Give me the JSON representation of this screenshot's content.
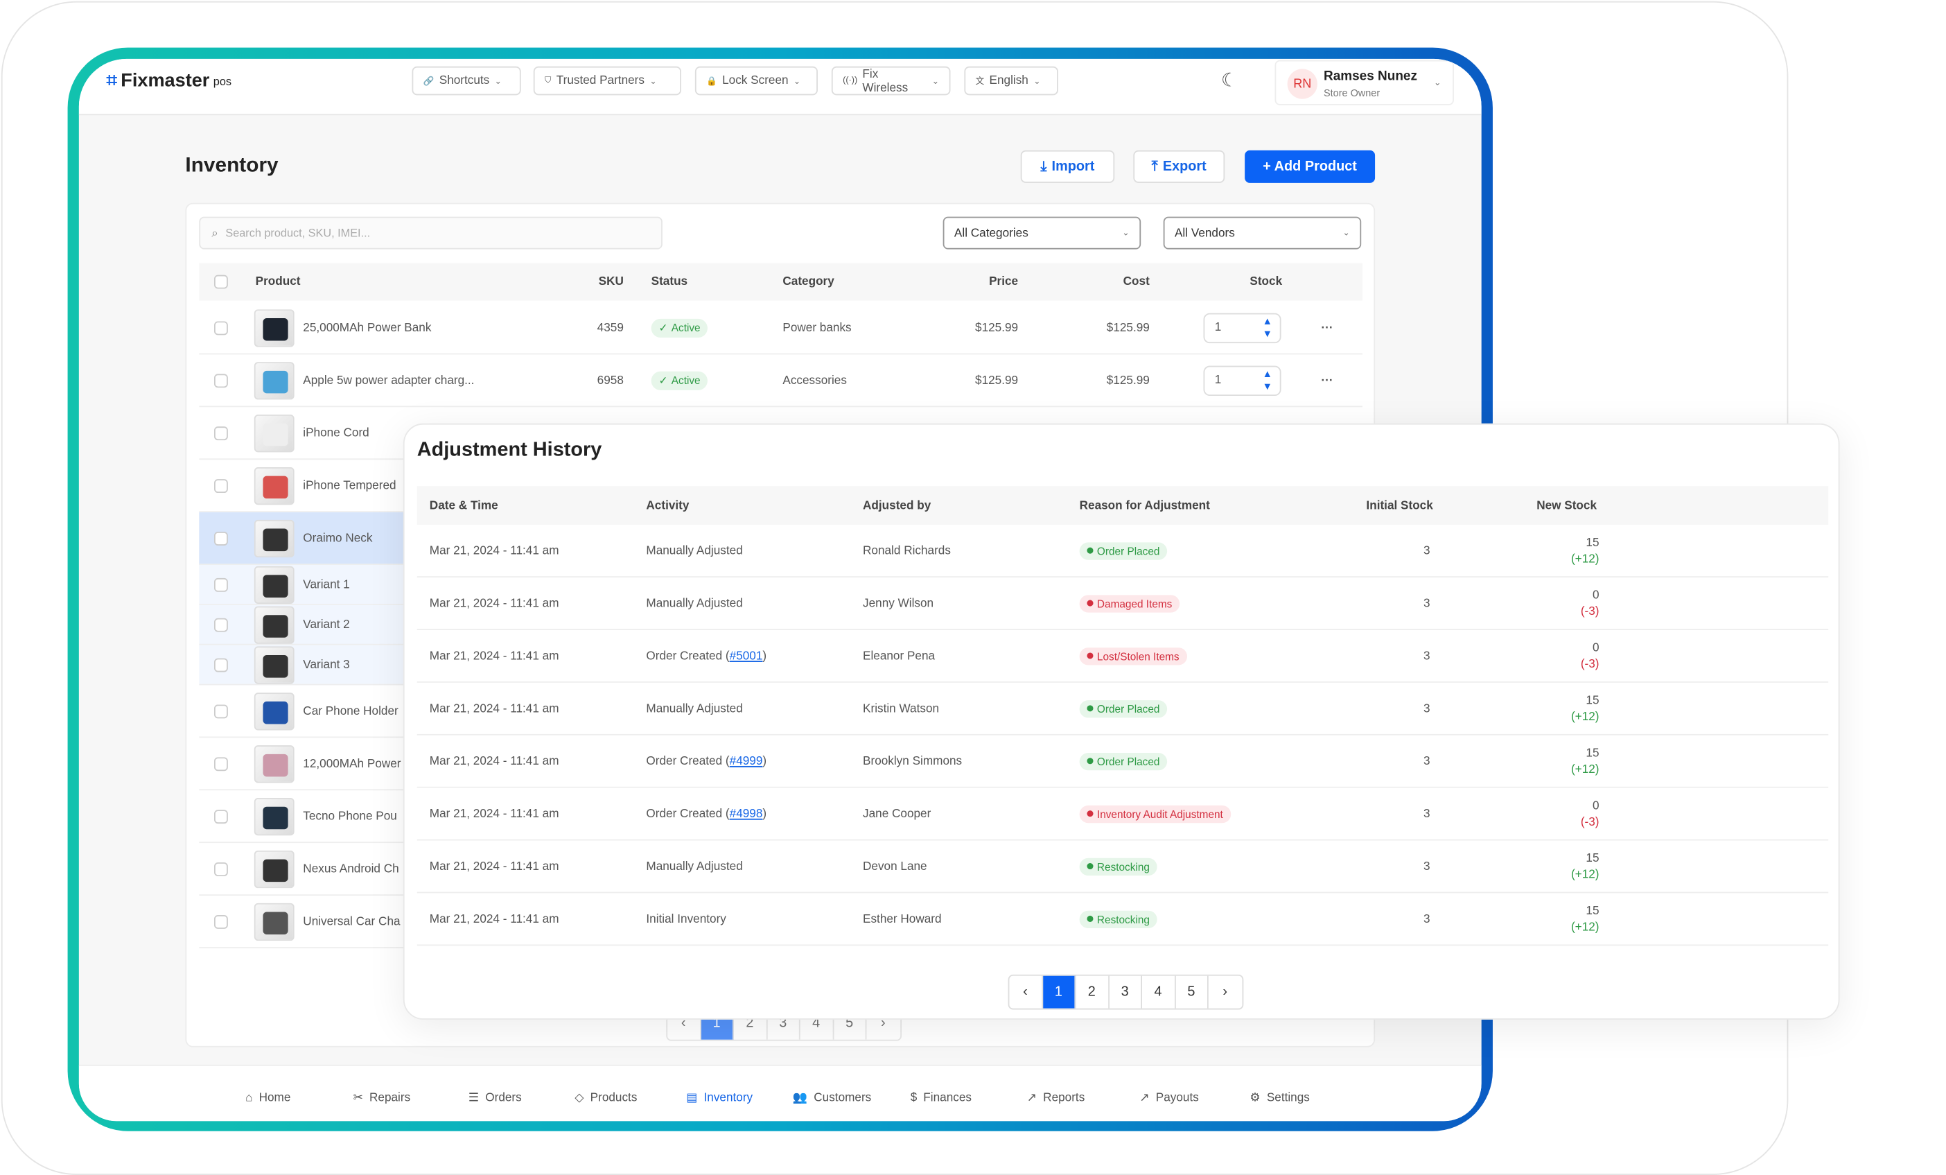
{
  "app": {
    "logo": "Fixmaster",
    "logo_sup": "pos"
  },
  "header": {
    "menus": [
      {
        "label": "Shortcuts",
        "icon": "link-icon"
      },
      {
        "label": "Trusted Partners",
        "icon": "shield-icon"
      },
      {
        "label": "Lock Screen",
        "icon": "lock-icon"
      },
      {
        "label": "Fix Wireless",
        "icon": "wireless-icon"
      },
      {
        "label": "English",
        "icon": "translate-icon"
      }
    ],
    "user": {
      "initials": "RN",
      "name": "Ramses Nunez",
      "role": "Store Owner"
    }
  },
  "page": {
    "title": "Inventory",
    "import": "Import",
    "export": "Export",
    "add": "+ Add Product"
  },
  "filters": {
    "search_placeholder": "Search product, SKU, IMEI...",
    "category": "All Categories",
    "vendor": "All Vendors"
  },
  "table": {
    "headers": {
      "product": "Product",
      "sku": "SKU",
      "status": "Status",
      "category": "Category",
      "price": "Price",
      "cost": "Cost",
      "stock": "Stock"
    },
    "rows": [
      {
        "name": "25,000MAh Power Bank",
        "sku": "4359",
        "status": "Active",
        "category": "Power banks",
        "price": "$125.99",
        "cost": "$125.99",
        "stock": "1"
      },
      {
        "name": "Apple 5w power adapter charg...",
        "sku": "6958",
        "status": "Active",
        "category": "Accessories",
        "price": "$125.99",
        "cost": "$125.99",
        "stock": "1"
      },
      {
        "name": "iPhone Cord"
      },
      {
        "name": "iPhone Tempered"
      },
      {
        "name": "Oraimo Neck"
      },
      {
        "name": "Variant 1"
      },
      {
        "name": "Variant 2"
      },
      {
        "name": "Variant 3"
      },
      {
        "name": "Car Phone Holder"
      },
      {
        "name": "12,000MAh Power"
      },
      {
        "name": "Tecno Phone Pou"
      },
      {
        "name": "Nexus Android Ch"
      },
      {
        "name": "Universal Car Cha"
      }
    ]
  },
  "modal": {
    "title": "Adjustment History",
    "headers": {
      "date": "Date & Time",
      "activity": "Activity",
      "by": "Adjusted by",
      "reason": "Reason for Adjustment",
      "initial": "Initial Stock",
      "new": "New Stock"
    },
    "rows": [
      {
        "date": "Mar 21, 2024 - 11:41 am",
        "activity": "Manually Adjusted",
        "order": "",
        "by": "Ronald Richards",
        "reason": "Order Placed",
        "type": "ok",
        "initial": "3",
        "new": "15",
        "delta": "(+12)"
      },
      {
        "date": "Mar 21, 2024 - 11:41 am",
        "activity": "Manually Adjusted",
        "order": "",
        "by": "Jenny Wilson",
        "reason": "Damaged Items",
        "type": "bad",
        "initial": "3",
        "new": "0",
        "delta": "(-3)"
      },
      {
        "date": "Mar 21, 2024 - 11:41 am",
        "activity": "Order Created",
        "order": "#5001",
        "by": "Eleanor Pena",
        "reason": "Lost/Stolen Items",
        "type": "bad",
        "initial": "3",
        "new": "0",
        "delta": "(-3)"
      },
      {
        "date": "Mar 21, 2024 - 11:41 am",
        "activity": "Manually Adjusted",
        "order": "",
        "by": "Kristin Watson",
        "reason": "Order Placed",
        "type": "ok",
        "initial": "3",
        "new": "15",
        "delta": "(+12)"
      },
      {
        "date": "Mar 21, 2024 - 11:41 am",
        "activity": "Order Created",
        "order": "#4999",
        "by": "Brooklyn Simmons",
        "reason": "Order Placed",
        "type": "ok",
        "initial": "3",
        "new": "15",
        "delta": "(+12)"
      },
      {
        "date": "Mar 21, 2024 - 11:41 am",
        "activity": "Order Created",
        "order": "#4998",
        "by": "Jane Cooper",
        "reason": "Inventory Audit Adjustment",
        "type": "bad",
        "initial": "3",
        "new": "0",
        "delta": "(-3)"
      },
      {
        "date": "Mar 21, 2024 - 11:41 am",
        "activity": "Manually Adjusted",
        "order": "",
        "by": "Devon Lane",
        "reason": "Restocking",
        "type": "ok",
        "initial": "3",
        "new": "15",
        "delta": "(+12)"
      },
      {
        "date": "Mar 21, 2024 - 11:41 am",
        "activity": "Initial Inventory",
        "order": "",
        "by": "Esther Howard",
        "reason": "Restocking",
        "type": "ok",
        "initial": "3",
        "new": "15",
        "delta": "(+12)"
      }
    ],
    "pages": [
      "1",
      "2",
      "3",
      "4",
      "5"
    ],
    "current_page": "1"
  },
  "nav": [
    {
      "label": "Home",
      "icon": "home-icon"
    },
    {
      "label": "Repairs",
      "icon": "tools-icon"
    },
    {
      "label": "Orders",
      "icon": "list-icon"
    },
    {
      "label": "Products",
      "icon": "tag-icon"
    },
    {
      "label": "Inventory",
      "icon": "inventory-icon",
      "active": true
    },
    {
      "label": "Customers",
      "icon": "users-icon"
    },
    {
      "label": "Finances",
      "icon": "dollar-icon"
    },
    {
      "label": "Reports",
      "icon": "trend-icon"
    },
    {
      "label": "Payouts",
      "icon": "arrow-up-right-icon"
    },
    {
      "label": "Settings",
      "icon": "gear-icon"
    }
  ],
  "colors": {
    "accent": "#0b63f6",
    "active_green": "#2e9a45",
    "alert_red": "#d32f3f",
    "frame_start": "#12c2ae",
    "frame_end": "#0a5bc4"
  }
}
